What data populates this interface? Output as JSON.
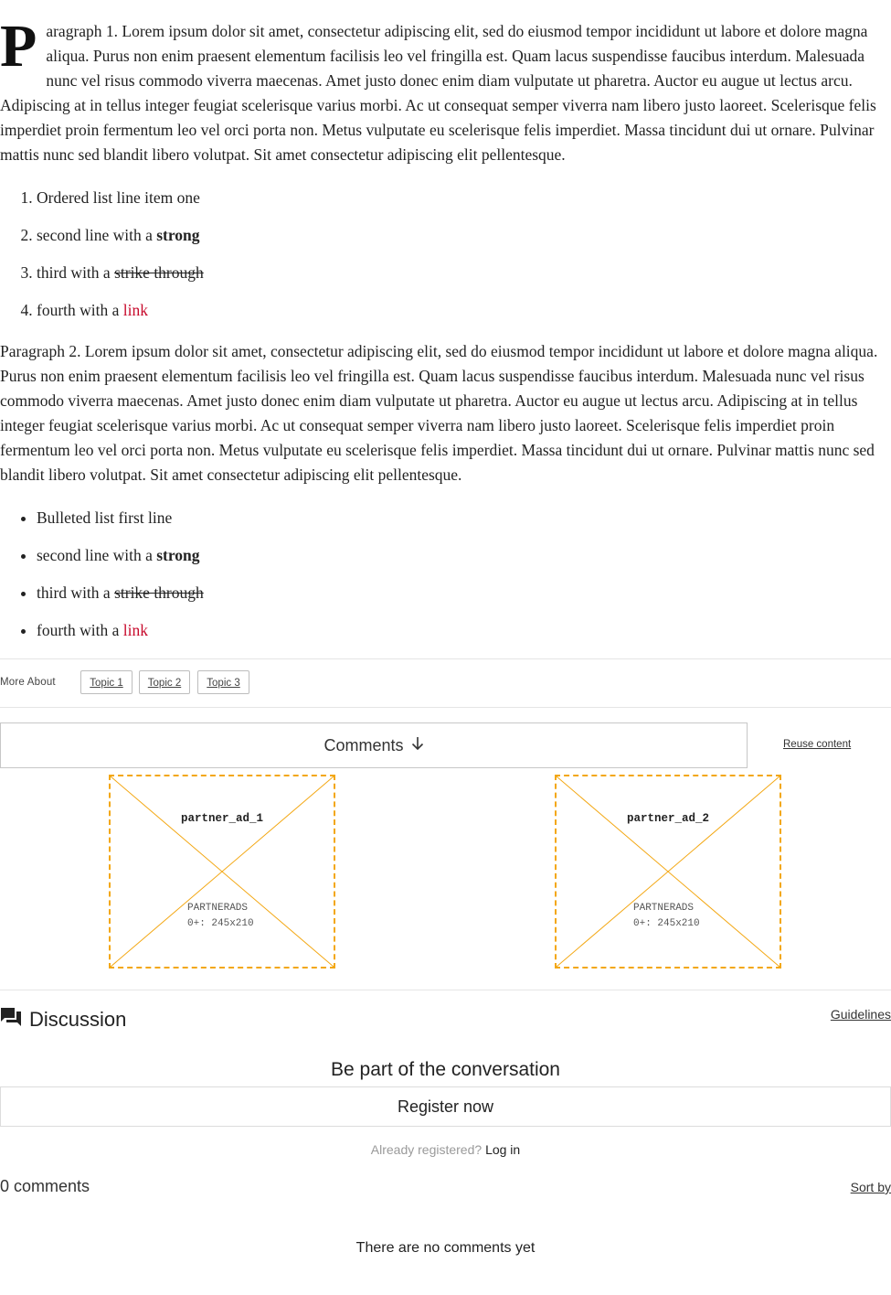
{
  "article": {
    "paragraph1": {
      "dropcap": "P",
      "text": "aragraph 1. Lorem ipsum dolor sit amet, consectetur adipiscing elit, sed do eiusmod tempor incididunt ut labore et dolore magna aliqua. Purus non enim praesent elementum facilisis leo vel fringilla est. Quam lacus suspendisse faucibus interdum. Malesuada nunc vel risus commodo viverra maecenas. Amet justo donec enim diam vulputate ut pharetra. Auctor eu augue ut lectus arcu. Adipiscing at in tellus integer feugiat scelerisque varius morbi. Ac ut consequat semper viverra nam libero justo laoreet. Scelerisque felis imperdiet proin fermentum leo vel orci porta non. Metus vulputate eu scelerisque felis imperdiet. Massa tincidunt dui ut ornare. Pulvinar mattis nunc sed blandit libero volutpat. Sit amet consectetur adipiscing elit pellentesque."
    },
    "ordered_list": {
      "item1": "Ordered list line item one",
      "item2_prefix": "second line with a ",
      "item2_strong": "strong",
      "item3_prefix": "third with a ",
      "item3_strike": "strike through",
      "item4_prefix": "fourth with a ",
      "item4_link": "link"
    },
    "paragraph2": "Paragraph 2. Lorem ipsum dolor sit amet, consectetur adipiscing elit, sed do eiusmod tempor incididunt ut labore et dolore magna aliqua. Purus non enim praesent elementum facilisis leo vel fringilla est. Quam lacus suspendisse faucibus interdum. Malesuada nunc vel risus commodo viverra maecenas. Amet justo donec enim diam vulputate ut pharetra. Auctor eu augue ut lectus arcu. Adipiscing at in tellus integer feugiat scelerisque varius morbi. Ac ut consequat semper viverra nam libero justo laoreet. Scelerisque felis imperdiet proin fermentum leo vel orci porta non. Metus vulputate eu scelerisque felis imperdiet. Massa tincidunt dui ut ornare. Pulvinar mattis nunc sed blandit libero volutpat. Sit amet consectetur adipiscing elit pellentesque.",
    "bulleted_list": {
      "item1": "Bulleted list first line",
      "item2_prefix": "second line with a ",
      "item2_strong": "strong",
      "item3_prefix": "third with a ",
      "item3_strike": "strike through",
      "item4_prefix": "fourth with a ",
      "item4_link": "link"
    }
  },
  "more_about": {
    "label": "More About",
    "topics": [
      "Topic 1",
      "Topic 2",
      "Topic 3"
    ]
  },
  "comments_button": {
    "label": "Comments",
    "icon": "arrow-down-icon"
  },
  "reuse_content": "Reuse content",
  "ads": [
    {
      "title": "partner_ad_1",
      "line1": "PARTNERADS",
      "line2": "0+: 245x210"
    },
    {
      "title": "partner_ad_2",
      "line1": "PARTNERADS",
      "line2": "0+: 245x210"
    }
  ],
  "discussion": {
    "icon": "forum-icon",
    "title": "Discussion",
    "guidelines": "Guidelines",
    "cta_heading": "Be part of the conversation",
    "register_label": "Register now",
    "already_registered": "Already registered?",
    "login_label": "Log in",
    "comment_count": "0 comments",
    "sort_by": "Sort by",
    "empty_message": "There are no comments yet"
  },
  "colors": {
    "link": "#c70a2c",
    "ad_border": "#f3a712",
    "muted_text": "#9a9a9a"
  }
}
